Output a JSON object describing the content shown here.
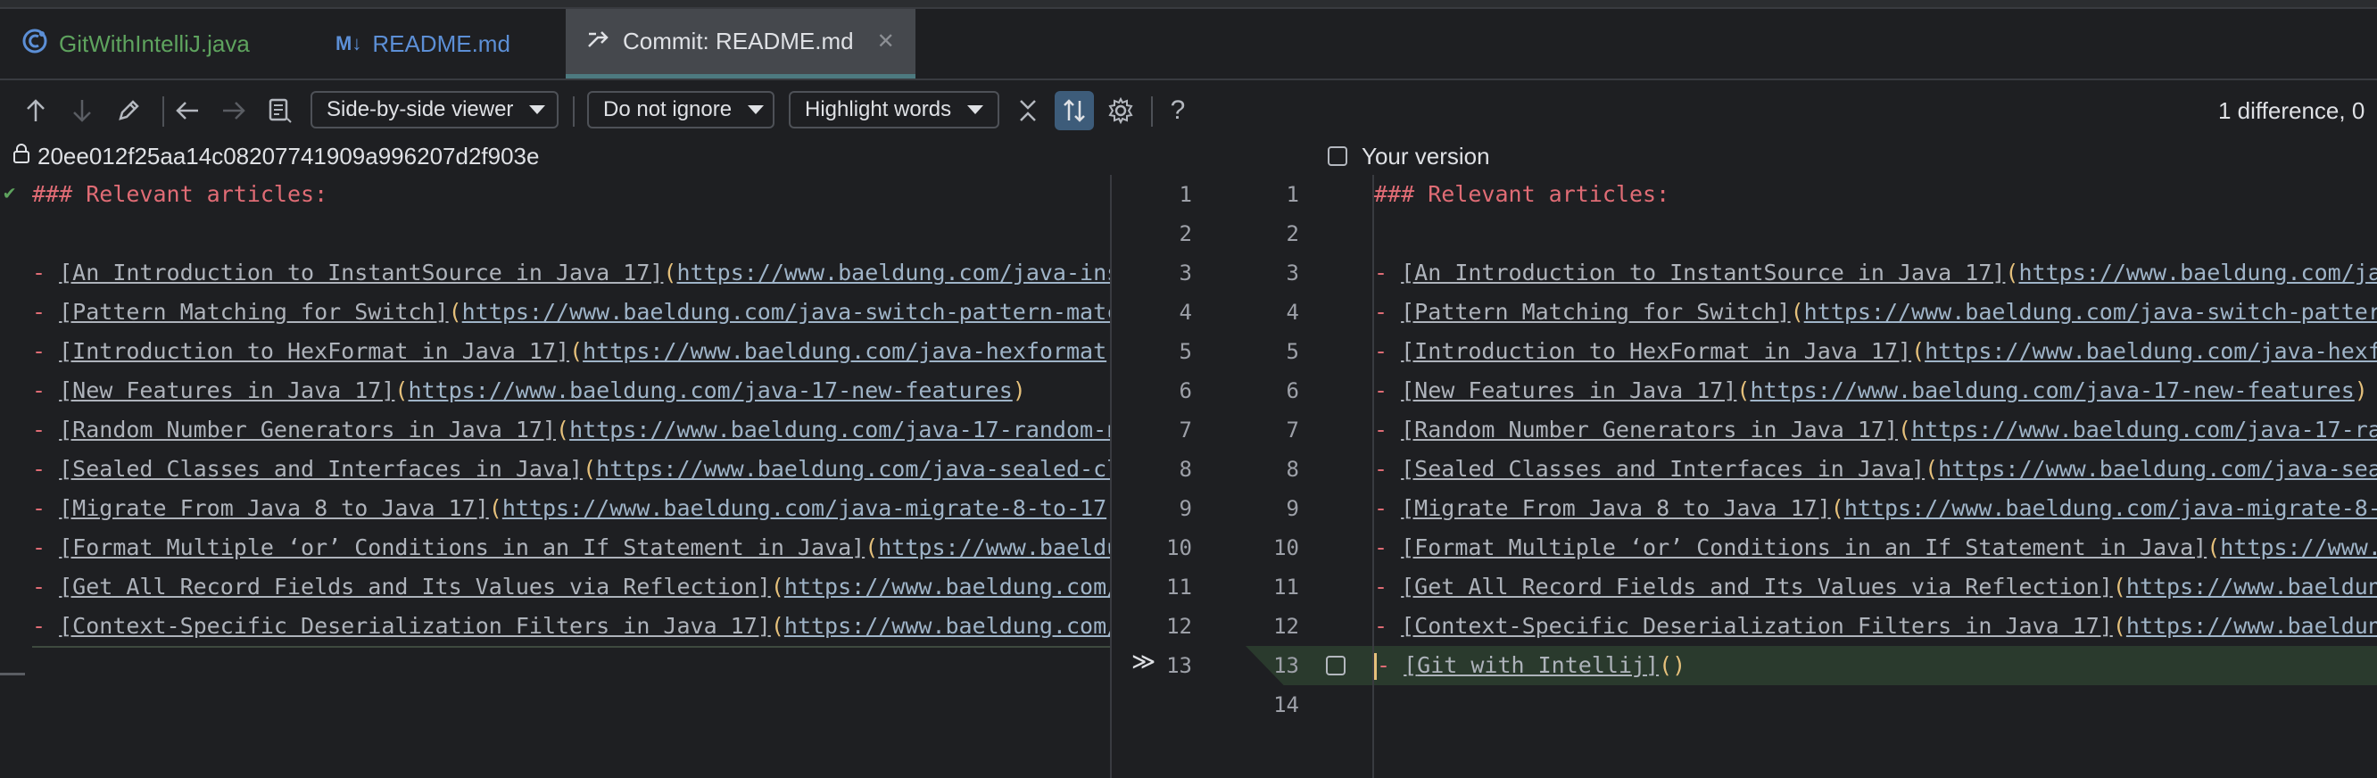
{
  "tabs": [
    {
      "label": "GitWithIntelliJ.java",
      "icon": "java-class-icon",
      "color": "#5ea35e"
    },
    {
      "label": "README.md",
      "icon": "markdown-icon",
      "color": "#5c8fd6"
    },
    {
      "label": "Commit: README.md",
      "icon": "commit-diff-icon",
      "color": "#dfe1e5",
      "active": true
    }
  ],
  "toolbar": {
    "viewer": "Side-by-side viewer",
    "ignore": "Do not ignore",
    "highlight": "Highlight words",
    "diff_count": "1 difference, 0"
  },
  "left_header": "20ee012f25aa14c08207741909a996207d2f903e",
  "right_header": "Your version",
  "lines": [
    {
      "n": 1,
      "heading": "### Relevant articles:"
    },
    {
      "n": 2
    },
    {
      "n": 3,
      "text": "An Introduction to InstantSource in Java 17",
      "url": "https://www.baeldung.com/java-instantsource"
    },
    {
      "n": 4,
      "text": "Pattern Matching for Switch",
      "url": "https://www.baeldung.com/java-switch-pattern-matching"
    },
    {
      "n": 5,
      "text": "Introduction to HexFormat in Java 17",
      "url": "https://www.baeldung.com/java-hexformat"
    },
    {
      "n": 6,
      "text": "New Features in Java 17",
      "url": "https://www.baeldung.com/java-17-new-features",
      "full": true
    },
    {
      "n": 7,
      "text": "Random Number Generators in Java 17",
      "url": "https://www.baeldung.com/java-17-random-number-generators"
    },
    {
      "n": 8,
      "text": "Sealed Classes and Interfaces in Java",
      "url": "https://www.baeldung.com/java-sealed-classes-interfaces"
    },
    {
      "n": 9,
      "text": "Migrate From Java 8 to Java 17",
      "url": "https://www.baeldung.com/java-migrate-8-to-17"
    },
    {
      "n": 10,
      "text": "Format Multiple ‘or’ Conditions in an If Statement in Java",
      "url": "https://www.baeldung.com/java-multiple-or-conditions-if-statement"
    },
    {
      "n": 11,
      "text": "Get All Record Fields and Its Values via Reflection",
      "url": "https://www.baeldung.com/java-reflection-record-fields-values"
    },
    {
      "n": 12,
      "text": "Context-Specific Deserialization Filters in Java 17",
      "url": "https://www.baeldung.com/java-context-specific-deserialization-filters"
    }
  ],
  "added_line": {
    "n": 13,
    "text": "Git with Intellij",
    "url": ""
  },
  "right_extra_line_number": 14,
  "left_next_line_number": 13
}
